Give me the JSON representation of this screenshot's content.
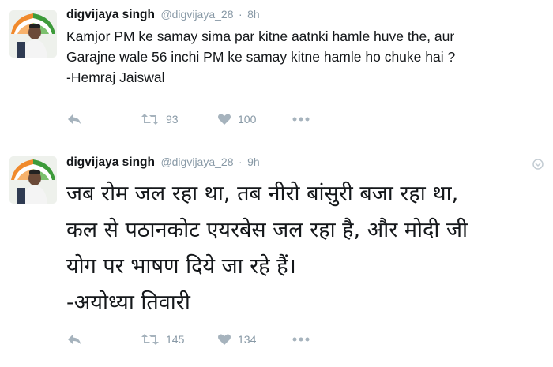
{
  "tweets": [
    {
      "author_name": "digvijaya singh",
      "handle": "@digvijaya_28",
      "separator": "·",
      "time": "8h",
      "text_lines": [
        "Kamjor PM ke samay sima par kitne aatnki hamle huve the, aur",
        "Garajne wale 56 inchi PM ke samay kitne hamle ho chuke hai ?",
        "-Hemraj Jaiswal"
      ],
      "retweets": "93",
      "likes": "100"
    },
    {
      "author_name": "digvijaya singh",
      "handle": "@digvijaya_28",
      "separator": "·",
      "time": "9h",
      "text_lines": [
        "जब रोम जल रहा था, तब नीरो बांसुरी बजा रहा था,",
        "कल से पठानकोट एयरबेस जल रहा है, और मोदी जी",
        "योग पर भाषण दिये जा रहे हैं।",
        "-अयोध्या तिवारी"
      ],
      "retweets": "145",
      "likes": "134"
    }
  ],
  "icons": {
    "reply": "reply-icon",
    "retweet": "retweet-icon",
    "like": "heart-icon",
    "more": "more-icon",
    "caret": "caret-down-icon"
  },
  "colors": {
    "text": "#14171a",
    "meta": "#8899a6",
    "action_icon": "#a6b3bd",
    "divider": "#e6ecf0"
  }
}
